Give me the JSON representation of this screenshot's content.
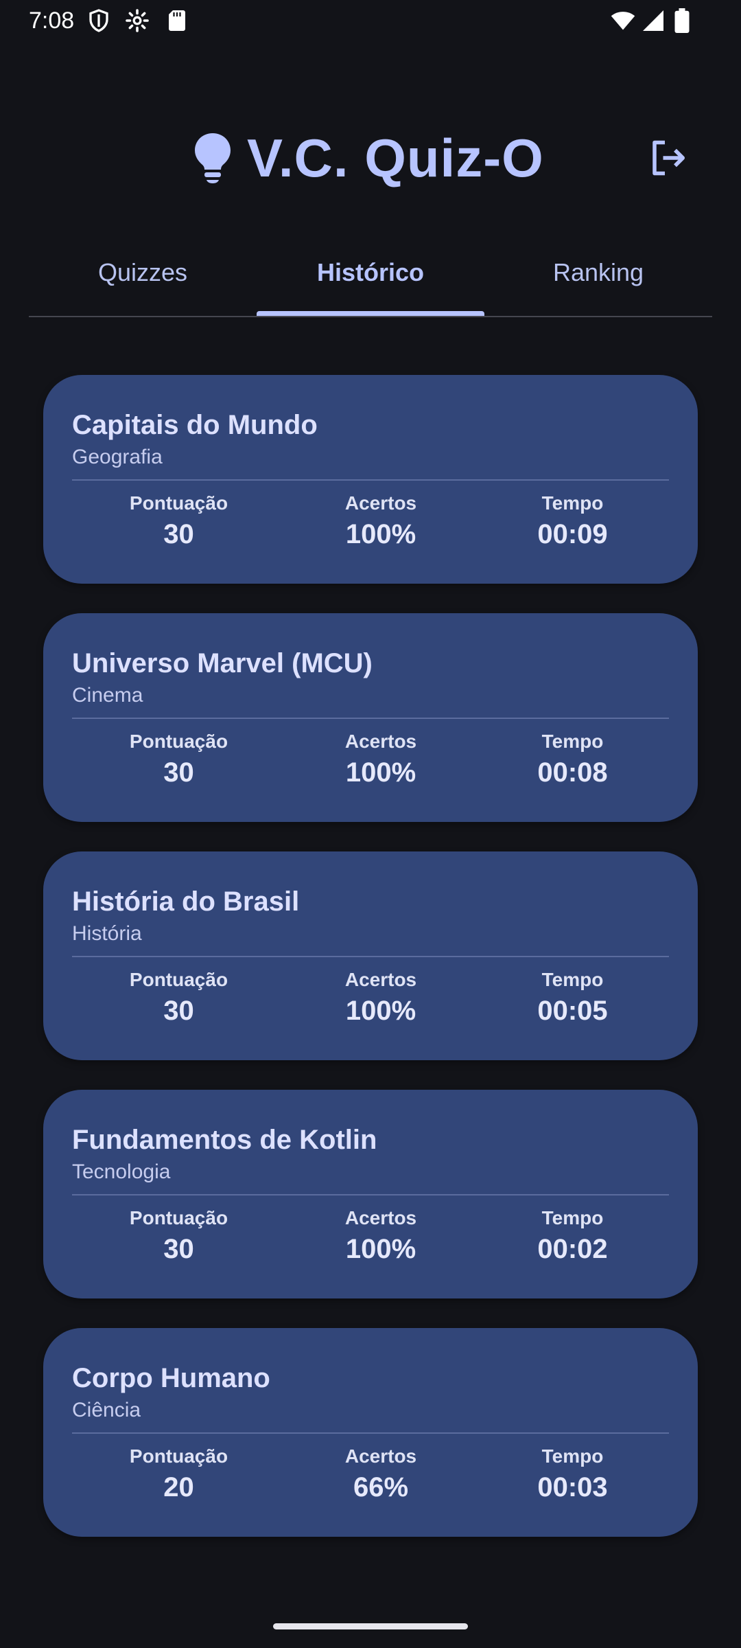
{
  "status_bar": {
    "time": "7:08",
    "icons": [
      "shield-icon",
      "gear-icon",
      "sd-card-icon",
      "wifi-icon",
      "signal-icon",
      "battery-icon"
    ]
  },
  "header": {
    "title": "V.C. Quiz-O",
    "logo_icon": "lightbulb-icon",
    "logout_icon": "logout-icon"
  },
  "tabs": [
    {
      "label": "Quizzes",
      "active": false
    },
    {
      "label": "Histórico",
      "active": true
    },
    {
      "label": "Ranking",
      "active": false
    }
  ],
  "history": {
    "stat_labels": {
      "score": "Pontuação",
      "accuracy": "Acertos",
      "time": "Tempo"
    },
    "items": [
      {
        "title": "Capitais do Mundo",
        "category": "Geografia",
        "score": "30",
        "accuracy": "100%",
        "time": "00:09"
      },
      {
        "title": "Universo Marvel (MCU)",
        "category": "Cinema",
        "score": "30",
        "accuracy": "100%",
        "time": "00:08"
      },
      {
        "title": "História do Brasil",
        "category": "História",
        "score": "30",
        "accuracy": "100%",
        "time": "00:05"
      },
      {
        "title": "Fundamentos de Kotlin",
        "category": "Tecnologia",
        "score": "30",
        "accuracy": "100%",
        "time": "00:02"
      },
      {
        "title": "Corpo Humano",
        "category": "Ciência",
        "score": "20",
        "accuracy": "66%",
        "time": "00:03"
      }
    ]
  },
  "colors": {
    "background": "#121318",
    "accent": "#b7c4ff",
    "card": "#324679"
  }
}
